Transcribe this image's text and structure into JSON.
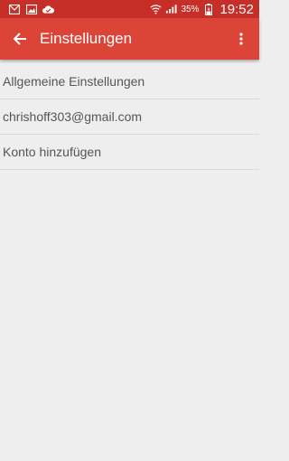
{
  "status_bar": {
    "battery_percent": "35%",
    "time": "19:52",
    "icons": [
      "gmail-notification-icon",
      "image-notification-icon",
      "checkmark-cloud-icon",
      "wifi-icon",
      "signal-icon",
      "battery-icon"
    ]
  },
  "app_bar": {
    "title": "Einstellungen",
    "back_icon": "arrow-back-icon",
    "menu_icon": "more-vert-icon"
  },
  "settings_list": [
    {
      "label": "Allgemeine Einstellungen"
    },
    {
      "label": "chrishoff303@gmail.com"
    },
    {
      "label": "Konto hinzufügen"
    }
  ],
  "colors": {
    "status_bar": "#c62f27",
    "app_bar": "#db4437",
    "background": "#eeeeee"
  }
}
